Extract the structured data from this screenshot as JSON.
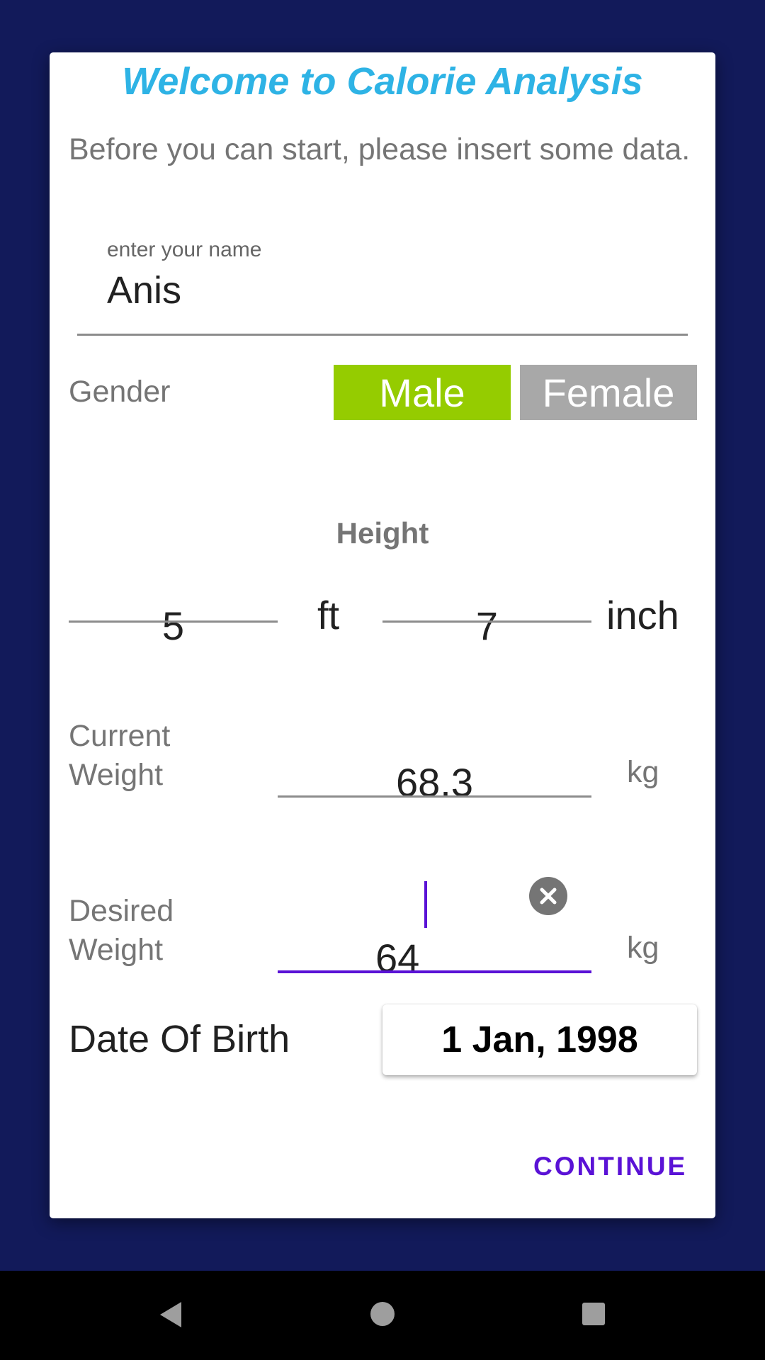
{
  "dialog": {
    "title": "Welcome to Calorie Analysis",
    "intro": "Before you can start, please insert some data."
  },
  "name": {
    "label": "enter your name",
    "value": "Anis"
  },
  "gender": {
    "label": "Gender",
    "options": [
      "Male",
      "Female"
    ],
    "selected": "Male",
    "selected_color": "#95cc00",
    "unselected_color": "#a8a8a8"
  },
  "height": {
    "label": "Height",
    "feet_value": "5",
    "feet_unit": "ft",
    "inch_value": "7",
    "inch_unit": "inch"
  },
  "current_weight": {
    "label": "Current Weight",
    "value": "68.3",
    "unit": "kg"
  },
  "desired_weight": {
    "label": "Desired Weight",
    "value": "64",
    "unit": "kg",
    "clear_icon": "close-circle-icon"
  },
  "dob": {
    "label": "Date Of Birth",
    "value": "1 Jan, 1998"
  },
  "actions": {
    "continue_label": "CONTINUE"
  },
  "colors": {
    "background": "#121a5a",
    "title": "#2eb3e5",
    "accent": "#5a12d6"
  },
  "system_nav": {
    "icons": [
      "back-icon",
      "home-icon",
      "recents-icon"
    ]
  }
}
